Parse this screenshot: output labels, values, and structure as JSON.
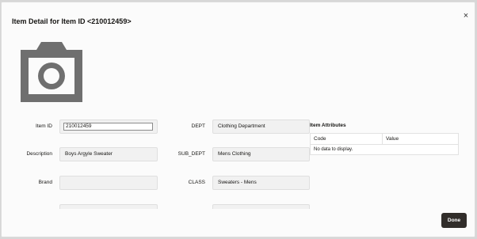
{
  "dialog": {
    "title": "Item Detail for Item ID <210012459>",
    "close_label": "×",
    "done_label": "Done"
  },
  "left_fields": {
    "item_id": {
      "label": "Item ID",
      "value": "210012459"
    },
    "description": {
      "label": "Description",
      "value": "Boys Argyle Sweater"
    },
    "brand": {
      "label": "Brand",
      "value": ""
    }
  },
  "right_fields": {
    "dept": {
      "label": "DEPT",
      "value": "Clothing Department"
    },
    "sub_dept": {
      "label": "SUB_DEPT",
      "value": "Mens Clothing"
    },
    "class": {
      "label": "CLASS",
      "value": "Sweaters - Mens"
    }
  },
  "attributes": {
    "title": "Item Attributes",
    "columns": [
      "Code",
      "Value"
    ],
    "empty_text": "No data to display."
  },
  "icons": {
    "image_placeholder": "camera-icon",
    "close": "close-icon"
  },
  "colors": {
    "button_bg": "#312d2a",
    "field_bg": "#f1f1f1",
    "icon_gray": "#6f6f6f"
  }
}
